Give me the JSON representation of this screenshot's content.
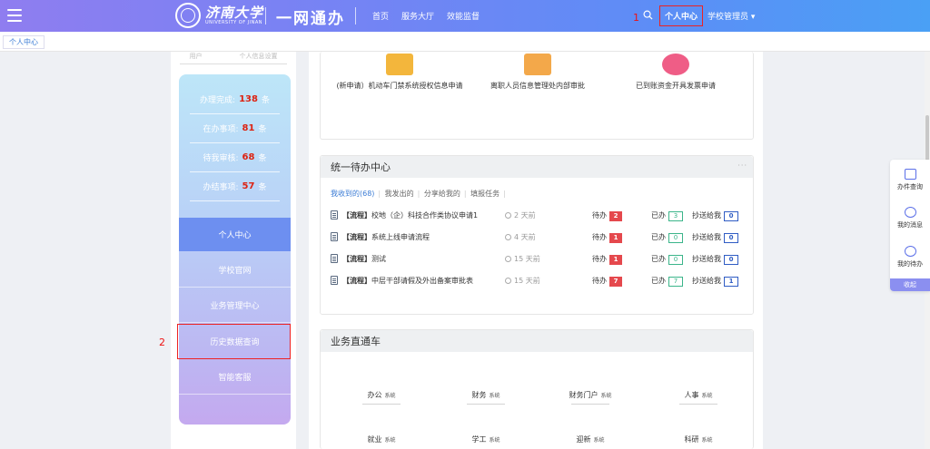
{
  "header": {
    "university_name": "济南大学",
    "university_en": "UNIVERSITY OF JINAN",
    "brand": "一网通办",
    "nav": [
      "首页",
      "服务大厅",
      "效能监督"
    ],
    "personal_center": "个人中心",
    "user_role": "学校管理员 ▾"
  },
  "annotations": {
    "one": "1",
    "two": "2"
  },
  "tabbar": {
    "active_tab": "个人中心"
  },
  "sidebar": {
    "top_cut": [
      "用户",
      "个人信息设置"
    ],
    "stats": [
      {
        "label": "办理完成:",
        "value": "138",
        "unit": "条"
      },
      {
        "label": "在办事项:",
        "value": "81",
        "unit": "条"
      },
      {
        "label": "待我审核:",
        "value": "68",
        "unit": "条"
      },
      {
        "label": "办结事项:",
        "value": "57",
        "unit": "条"
      }
    ],
    "nav": [
      "个人中心",
      "学校官网",
      "业务管理中心",
      "历史数据查询",
      "智能客服"
    ]
  },
  "apps": [
    {
      "label": "(新申请）机动车门禁系统授权信息申请"
    },
    {
      "label": "离职人员信息管理处内部审批"
    },
    {
      "label": "已到账资金开具发票申请"
    }
  ],
  "todo": {
    "title": "统一待办中心",
    "tabs": [
      "我收到的(68)",
      "我发出的",
      "分享给我的",
      "填报任务"
    ],
    "pending_label": "待办",
    "done_label": "已办",
    "cc_label": "抄送给我",
    "rows": [
      {
        "tag": "【流程】",
        "title": "校地（企）科技合作类协议申请1",
        "time": "2 天前",
        "pending": "2",
        "done": "3",
        "cc": "0"
      },
      {
        "tag": "【流程】",
        "title": "系统上线申请流程",
        "time": "4 天前",
        "pending": "1",
        "done": "0",
        "cc": "0"
      },
      {
        "tag": "【流程】",
        "title": "测试",
        "time": "15 天前",
        "pending": "1",
        "done": "0",
        "cc": "0"
      },
      {
        "tag": "【流程】",
        "title": "中层干部请假及外出备案审批表",
        "time": "15 天前",
        "pending": "7",
        "done": "7",
        "cc": "1"
      }
    ]
  },
  "business": {
    "title": "业务直通车",
    "suffix": "系统",
    "systems": [
      "办公",
      "财务",
      "财务门户",
      "人事",
      "就业",
      "学工",
      "迎新",
      "科研"
    ]
  },
  "float_panel": {
    "items": [
      "办件查询",
      "我的消息",
      "我的待办"
    ],
    "collapse": "收起"
  }
}
